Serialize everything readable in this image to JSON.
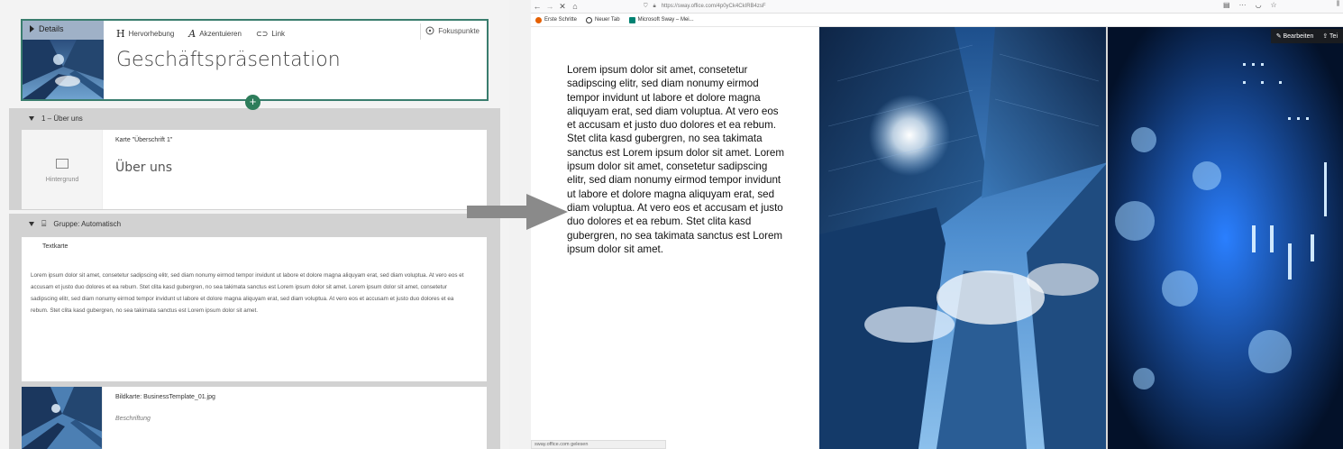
{
  "editor": {
    "title_card": {
      "details_label": "Details",
      "toolbar": [
        {
          "glyph": "H",
          "label": "Hervorhebung"
        },
        {
          "glyph": "A",
          "label": "Akzentuieren"
        },
        {
          "glyph": "⊂⊃",
          "label": "Link"
        }
      ],
      "fokus_label": "Fokuspunkte",
      "title": "Geschäftspräsentation"
    },
    "section1": {
      "header": "1 – Über uns",
      "card_label": "Karte \"Überschrift 1\"",
      "card_heading": "Über uns",
      "background_label": "Hintergrund"
    },
    "section2": {
      "header": "Gruppe: Automatisch",
      "text_card_label": "Textkarte",
      "text_card_body": "Lorem ipsum dolor sit amet, consetetur sadipscing elitr, sed diam nonumy eirmod tempor invidunt ut labore et dolore magna aliquyam erat, sed diam voluptua. At vero eos et accusam et justo duo dolores et ea rebum. Stet clita kasd gubergren, no sea takimata sanctus est Lorem ipsum dolor sit amet. Lorem ipsum dolor sit amet, consetetur sadipscing elitr, sed diam nonumy eirmod tempor invidunt ut labore et dolore magna aliquyam erat, sed diam voluptua. At vero eos et accusam et justo duo dolores et ea rebum. Stet clita kasd gubergren, no sea takimata sanctus est Lorem ipsum dolor sit amet.",
      "image_card_label": "Bildkarte: BusinessTemplate_01.jpg",
      "caption_placeholder": "Beschriftung"
    }
  },
  "browser": {
    "url": "https://sway.office.com/4p0yCk4CkIRB4zsF",
    "bookmarks": [
      "Erste Schritte",
      "Neuer Tab",
      "Microsoft Sway – Mei..."
    ],
    "edit_button": "Bearbeiten",
    "share_button": "Tei",
    "body_text": "Lorem ipsum dolor sit amet, consetetur sadipscing elitr, sed diam nonumy eirmod tempor invidunt ut labore et dolore magna aliquyam erat, sed diam voluptua. At vero eos et accusam et justo duo dolores et ea rebum. Stet clita kasd gubergren, no sea takimata sanctus est Lorem ipsum dolor sit amet. Lorem ipsum dolor sit amet, consetetur sadipscing elitr, sed diam nonumy eirmod tempor invidunt ut labore et dolore magna aliquyam erat, sed diam voluptua. At vero eos et accusam et justo duo dolores et ea rebum. Stet clita kasd gubergren, no sea takimata sanctus est Lorem ipsum dolor sit amet.",
    "status_text": "sway.office.com gelesen"
  },
  "colors": {
    "accent_green": "#2e7d5b",
    "selected_border": "#3a7d6e",
    "section_bg": "#d2d2d2",
    "arrow": "#8a8a8a"
  }
}
